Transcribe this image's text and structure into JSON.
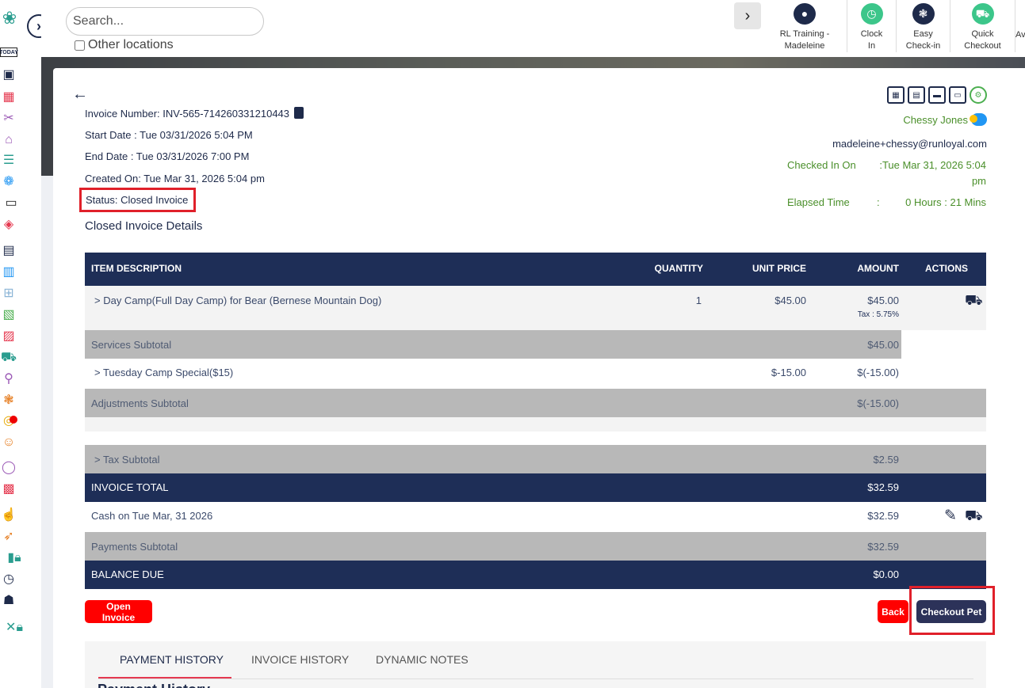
{
  "search": {
    "placeholder": "Search..."
  },
  "other_locations_label": "Other locations",
  "rail": {
    "today_label": "TODAY",
    "icons": [
      "paw-logo-icon",
      "today-icon",
      "dashboard-icon",
      "calendar-icon",
      "grooming-icon",
      "store-icon",
      "list-icon",
      "pet-icon",
      "today-checkin-icon",
      "tags-icon",
      "schedule-icon",
      "calendar-alt-icon",
      "grid-icon",
      "report-icon",
      "clipboard-icon",
      "cart-icon",
      "shopping-icon",
      "paw-icon",
      "chart-icon",
      "user-icon",
      "chat-icon",
      "image-icon",
      "thumbs-up-icon",
      "rocket-icon",
      "analytics-lock-icon",
      "clock-icon",
      "people-icon",
      "tools-lock-icon"
    ]
  },
  "quick_actions": [
    {
      "line1": "RL Training -",
      "line2": "Madeleine",
      "icon": "location-pin-icon",
      "color": "#1e2a4a"
    },
    {
      "line1": "Clock",
      "line2": "In",
      "icon": "clock-icon",
      "color": "#3cc68a"
    },
    {
      "line1": "Easy",
      "line2": "Check-in",
      "icon": "paw-icon",
      "color": "#1e2a4a"
    },
    {
      "line1": "Quick",
      "line2": "Checkout",
      "icon": "cart-icon",
      "color": "#3cc68a"
    },
    {
      "line1": "Av",
      "line2": "",
      "icon": "",
      "color": ""
    }
  ],
  "invoice": {
    "number_label": "Invoice Number: INV-565-714260331210443",
    "start_date": "Start Date : Tue 03/31/2026 5:04 PM",
    "end_date": "End Date : Tue 03/31/2026 7:00 PM",
    "created_on": "Created On: Tue Mar 31, 2026 5:04 pm",
    "status": "Status: Closed Invoice",
    "section_title": "Closed Invoice Details"
  },
  "customer": {
    "name": "Chessy Jones",
    "email": "madeleine+chessy@runloyal.com",
    "checked_in_label": "Checked In On",
    "checked_in_value_1": ":Tue Mar 31, 2026 5:04",
    "checked_in_value_2": "pm",
    "elapsed_label": "Elapsed Time",
    "elapsed_sep": ":",
    "elapsed_value": "0 Hours : 21 Mins"
  },
  "table": {
    "headers": {
      "description": "ITEM DESCRIPTION",
      "quantity": "QUANTITY",
      "unit_price": "UNIT PRICE",
      "amount": "AMOUNT",
      "actions": "ACTIONS"
    },
    "item": {
      "description": ">  Day Camp(Full Day Camp) for Bear (Bernese Mountain Dog)",
      "quantity": "1",
      "unit_price": "$45.00",
      "amount": "$45.00",
      "tax": "Tax : 5.75%"
    },
    "services_subtotal": {
      "label": "Services Subtotal",
      "amount": "$45.00"
    },
    "adjustment": {
      "description": ">  Tuesday Camp Special($15)",
      "unit_price": "$-15.00",
      "amount": "$(-15.00)"
    },
    "adjustments_subtotal": {
      "label": "Adjustments Subtotal",
      "amount": "$(-15.00)"
    },
    "tax_subtotal": {
      "label": ">  Tax Subtotal",
      "amount": "$2.59"
    },
    "invoice_total": {
      "label": "INVOICE TOTAL",
      "amount": "$32.59"
    },
    "payment": {
      "label": "Cash on Tue Mar, 31 2026",
      "amount": "$32.59"
    },
    "payments_subtotal": {
      "label": "Payments Subtotal",
      "amount": "$32.59"
    },
    "balance_due": {
      "label": "BALANCE DUE",
      "amount": "$0.00"
    }
  },
  "buttons": {
    "open_invoice": "Open Invoice",
    "back": "Back",
    "checkout_pet": "Checkout Pet"
  },
  "tabs": [
    "PAYMENT HISTORY",
    "INVOICE HISTORY",
    "DYNAMIC NOTES"
  ],
  "payment_history_title": "Payment History"
}
